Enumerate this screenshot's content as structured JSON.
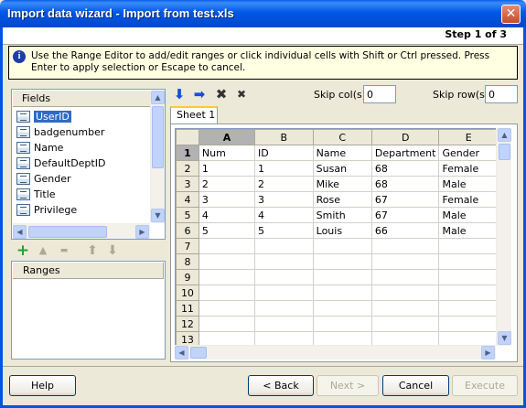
{
  "window": {
    "title": "Import data wizard - Import from test.xls",
    "close_symbol": "✕"
  },
  "step": {
    "text": "Step 1 of 3"
  },
  "info": {
    "icon": "info-icon",
    "text": "Use the Range Editor to add/edit ranges or click individual cells with Shift or Ctrl pressed. Press Enter to apply selection or Escape to cancel."
  },
  "fields": {
    "header": "Fields",
    "items": [
      {
        "label": "UserID",
        "selected": true
      },
      {
        "label": "badgenumber"
      },
      {
        "label": "Name"
      },
      {
        "label": "DefaultDeptID"
      },
      {
        "label": "Gender"
      },
      {
        "label": "Title"
      },
      {
        "label": "Privilege"
      }
    ]
  },
  "field_tools": {
    "add": "+",
    "up": "▲",
    "remove": "▬",
    "move_up": "⬆",
    "move_down": "⬇"
  },
  "ranges": {
    "header": "Ranges"
  },
  "top_tools": {
    "arrow_down": "⬇",
    "arrow_right": "➡",
    "delete": "✖",
    "delete_all": "✖"
  },
  "skip": {
    "cols_label": "Skip col(s)",
    "cols_value": "0",
    "rows_label": "Skip row(s)",
    "rows_value": "0"
  },
  "sheet": {
    "tab": "Sheet 1"
  },
  "grid": {
    "columns": [
      "A",
      "B",
      "C",
      "D",
      "E"
    ],
    "row_numbers": [
      "1",
      "2",
      "3",
      "4",
      "5",
      "6",
      "7",
      "8",
      "9",
      "10",
      "11",
      "12",
      "13"
    ],
    "rows": [
      [
        "Num",
        "ID",
        "Name",
        "Department",
        "Gender"
      ],
      [
        "1",
        "1",
        "Susan",
        "68",
        "Female"
      ],
      [
        "2",
        "2",
        "Mike",
        "68",
        "Male"
      ],
      [
        "3",
        "3",
        "Rose",
        "67",
        "Female"
      ],
      [
        "4",
        "4",
        "Smith",
        "67",
        "Male"
      ],
      [
        "5",
        "5",
        "Louis",
        "66",
        "Male"
      ],
      [
        "",
        "",
        "",
        "",
        ""
      ],
      [
        "",
        "",
        "",
        "",
        ""
      ],
      [
        "",
        "",
        "",
        "",
        ""
      ],
      [
        "",
        "",
        "",
        "",
        ""
      ],
      [
        "",
        "",
        "",
        "",
        ""
      ],
      [
        "",
        "",
        "",
        "",
        ""
      ],
      [
        "",
        "",
        "",
        "",
        ""
      ]
    ]
  },
  "buttons": {
    "help": "Help",
    "back": "< Back",
    "next": "Next >",
    "cancel": "Cancel",
    "execute": "Execute"
  }
}
